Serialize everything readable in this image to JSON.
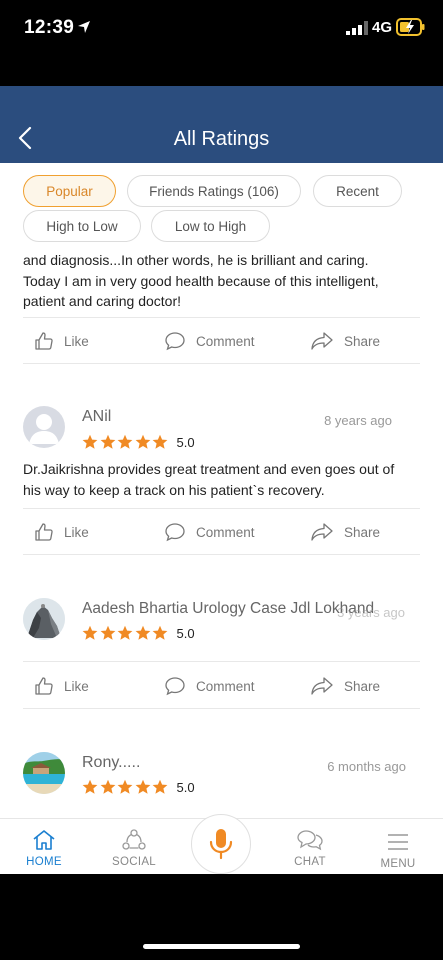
{
  "status_bar": {
    "time": "12:39",
    "network": "4G"
  },
  "header": {
    "title": "All Ratings"
  },
  "filters": [
    {
      "label": "Popular",
      "active": true
    },
    {
      "label": "Friends Ratings (106)",
      "active": false
    },
    {
      "label": "Recent",
      "active": false
    },
    {
      "label": "High to Low",
      "active": false
    },
    {
      "label": "Low to High",
      "active": false
    }
  ],
  "actions": {
    "like": "Like",
    "comment": "Comment",
    "share": "Share"
  },
  "reviews": [
    {
      "text_lines": [
        "and diagnosis...In other words, he is brilliant and caring.",
        "Today I am in very good health because of this intelligent,",
        "patient and caring doctor!"
      ]
    },
    {
      "name": "ANil",
      "time": "8 years ago",
      "rating": "5.0",
      "stars": 5,
      "text_lines": [
        "Dr.Jaikrishna provides great treatment and even goes out of",
        "his way to keep a track on his patient`s recovery."
      ]
    },
    {
      "name": "Aadesh Bhartia Urology Case Jdl Lokhand",
      "time": "3 years ago",
      "rating": "5.0",
      "stars": 5
    },
    {
      "name": "Rony.....",
      "time": "6 months ago",
      "rating": "5.0",
      "stars": 5
    }
  ],
  "tabbar": {
    "home": "HOME",
    "social": "SOCIAL",
    "chat": "CHAT",
    "menu": "MENU"
  },
  "colors": {
    "header_bg": "#2b4d7e",
    "accent_orange": "#f0a030",
    "star": "#f08a24",
    "active_tab": "#1a7fd0"
  }
}
